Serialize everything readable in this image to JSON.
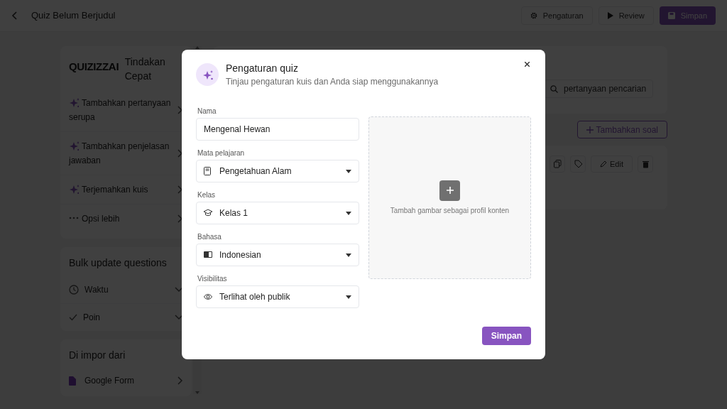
{
  "header": {
    "title": "Quiz Belum Berjudul",
    "buttons": [
      {
        "label": "Pengaturan",
        "kind": "settings"
      },
      {
        "label": "Review",
        "kind": "review"
      },
      {
        "label": "Simpan",
        "kind": "save"
      }
    ]
  },
  "sidebar": {
    "quick_actions": {
      "logo": "QUIZIZZ",
      "logo_ai": "AI",
      "title": "Tindakan Cepat",
      "items": [
        {
          "label": "Tambahkan pertanyaan serupa",
          "kind": "ai"
        },
        {
          "label": "Tambahkan penjelasan jawaban",
          "kind": "ai"
        },
        {
          "label": "Terjemahkan kuis",
          "kind": "ai"
        },
        {
          "label": "Opsi lebih",
          "kind": "more"
        }
      ]
    },
    "bulk_update": {
      "title": "Bulk update questions",
      "items": [
        {
          "label": "Waktu",
          "kind": "time"
        },
        {
          "label": "Poin",
          "kind": "points"
        }
      ]
    },
    "import": {
      "title": "Di impor dari",
      "items": [
        {
          "label": "Google Form",
          "kind": "file"
        }
      ]
    }
  },
  "main": {
    "search": {
      "placeholder": "pertanyaan pencarian"
    },
    "add_question": "Tambahkan soal",
    "edit": "Edit"
  },
  "dialog": {
    "title": "Pengaturan quiz",
    "subtitle": "Tinjau pengaturan kuis dan Anda siap menggunakannya",
    "fields": [
      {
        "label": "Nama",
        "value": "Mengenal Hewan",
        "kind": "text"
      },
      {
        "label": "Mata pelajaran",
        "value": "Pengetahuan Alam",
        "kind": "subject"
      },
      {
        "label": "Kelas",
        "value": "Kelas 1",
        "kind": "grade"
      },
      {
        "label": "Bahasa",
        "value": "Indonesian",
        "kind": "language"
      },
      {
        "label": "Visibilitas",
        "value": "Terlihat oleh publik",
        "kind": "visibility"
      }
    ],
    "image_hint": "Tambah gambar sebagai profil konten",
    "save": "Simpan"
  }
}
